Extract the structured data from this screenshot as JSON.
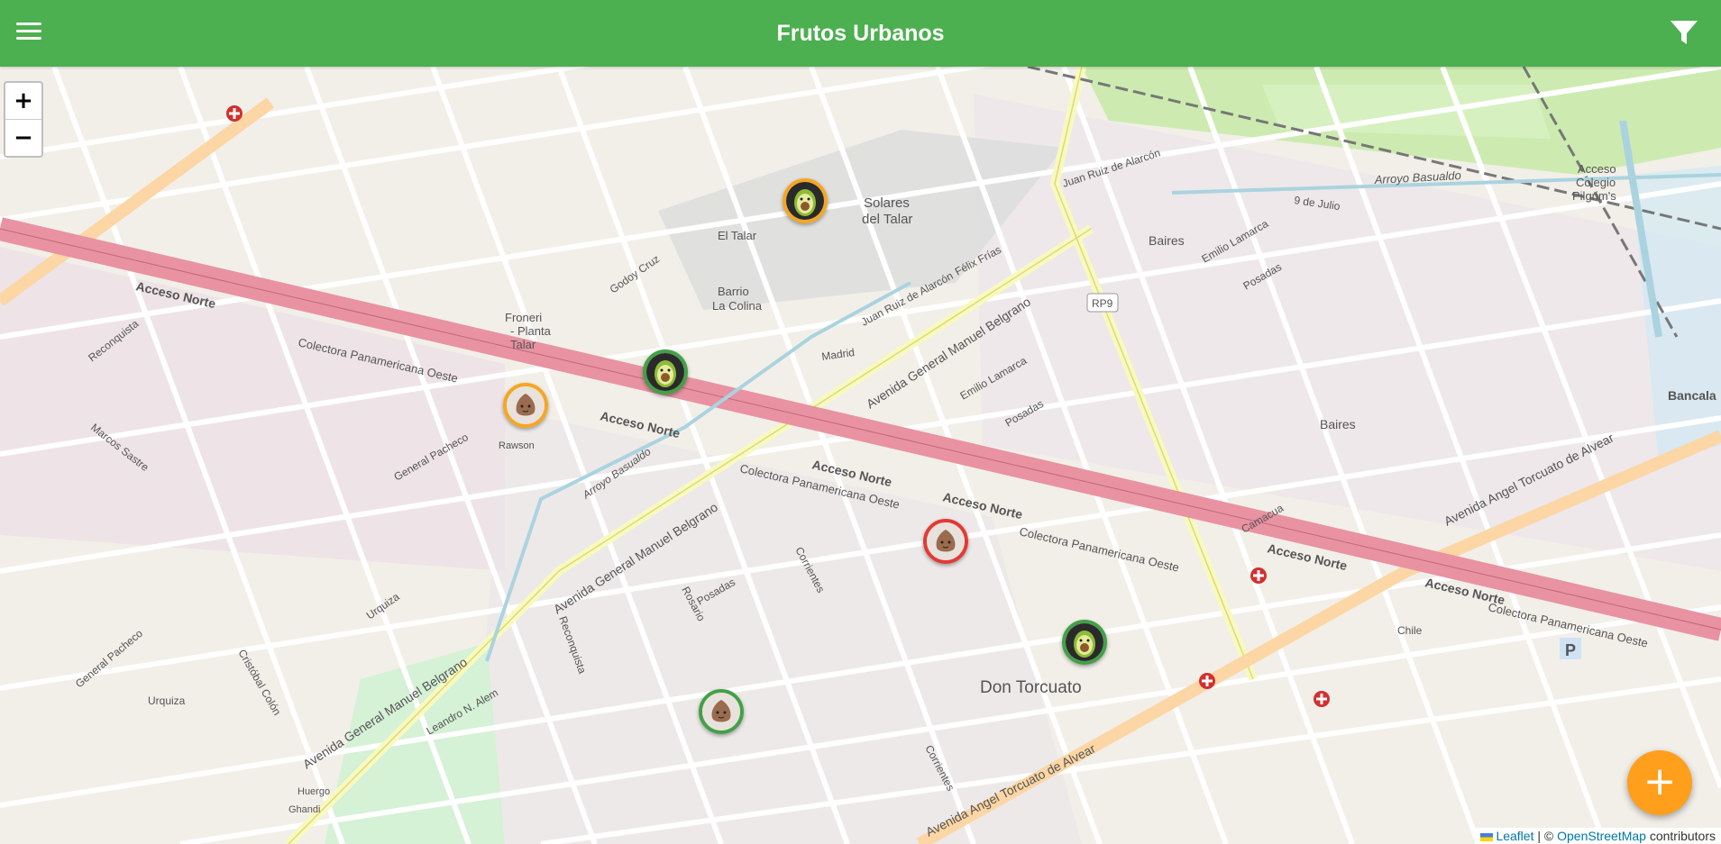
{
  "app": {
    "title": "Frutos Urbanos"
  },
  "toolbar": {
    "menu_icon": "hamburger-menu-icon",
    "filter_icon": "filter-funnel-icon"
  },
  "zoom": {
    "in_label": "+",
    "out_label": "−"
  },
  "fab": {
    "label": "+",
    "icon": "add-icon",
    "color": "#ff9f1c"
  },
  "attribution": {
    "leaflet": "Leaflet",
    "separator": " | © ",
    "osm": "OpenStreetMap",
    "suffix": " contributors"
  },
  "markers": [
    {
      "id": "m1",
      "fruit": "avocado",
      "ring": "#f5a623"
    },
    {
      "id": "m2",
      "fruit": "avocado",
      "ring": "#43a047"
    },
    {
      "id": "m3",
      "fruit": "fig",
      "ring": "#f5a623"
    },
    {
      "id": "m4",
      "fruit": "fig",
      "ring": "#e53935"
    },
    {
      "id": "m5",
      "fruit": "avocado",
      "ring": "#43a047"
    },
    {
      "id": "m6",
      "fruit": "fig",
      "ring": "#43a047"
    }
  ],
  "map_labels": {
    "acceso_norte": "Acceso Norte",
    "colectora": "Colectora Panamericana Oeste",
    "belgrano": "Avenida General Manuel Belgrano",
    "alvear": "Avenida Angel Torcuato de Alvear",
    "don_torcuato": "Don Torcuato",
    "baires": "Baires",
    "solares": "Solares",
    "del_talar": "del Talar",
    "el_talar": "El Talar",
    "barrio": "Barrio",
    "la_colina": "La Colina",
    "froneri_1": "Froneri",
    "froneri_2": "- Planta",
    "froneri_3": "Talar",
    "rp9": "RP9",
    "arroyo_basualdo": "Arroyo Basualdo",
    "nueve_de_julio": "9 de Julio",
    "acceso_colegio_1": "Acceso",
    "acceso_colegio_2": "Colegio",
    "acceso_colegio_3": "Pilgrim's",
    "bancala": "Bancala",
    "madrid": "Madrid",
    "general_pacheco": "General Pacheco",
    "marcos_sastre": "Marcos Sastre",
    "reconquista": "Reconquista",
    "cristobal_colon": "Cristóbal Colón",
    "godoy_cruz": "Godoy Cruz",
    "juan_ruiz_de_alarcon": "Juan Ruiz de Alarcón",
    "felix_frias": "Félix Frías",
    "emilio_lamarca": "Emilio Lamarca",
    "posadas": "Posadas",
    "corrientes": "Corrientes",
    "rosario": "Rosario",
    "urquiza": "Urquiza",
    "leandro_alem": "Leandro N. Alem",
    "rawson": "Rawson",
    "chile": "Chile",
    "camacua": "Camacua",
    "p_sign": "P",
    "huergo": "Huergo",
    "ghandi": "Ghandi"
  }
}
